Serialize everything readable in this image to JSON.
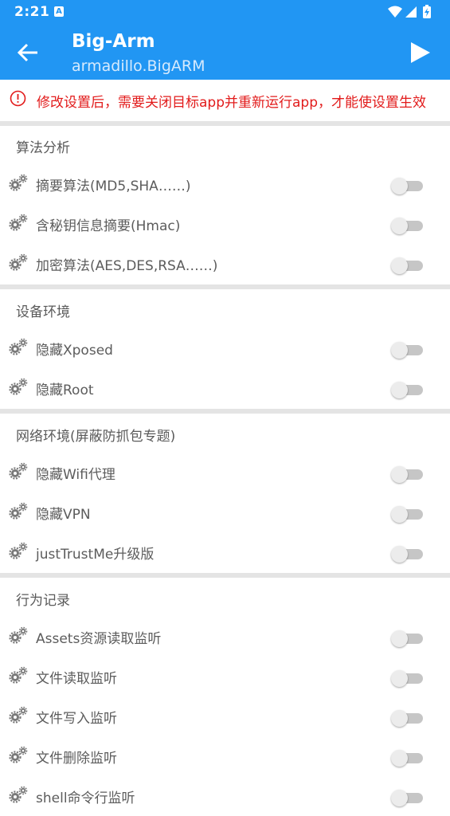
{
  "status_bar": {
    "time": "2:21",
    "notification_icon": "A"
  },
  "app_bar": {
    "title": "Big-Arm",
    "subtitle": "armadillo.BigARM",
    "back_icon": "arrow-left-icon",
    "action_icon": "play-icon"
  },
  "warning": {
    "icon": "alert-circle-icon",
    "text": "修改设置后，需要关闭目标app并重新运行app，才能使设置生效",
    "color": "#e21b1b"
  },
  "colors": {
    "primary": "#2196f3",
    "switch_off_track": "#c6c6c6",
    "switch_off_thumb": "#ececec"
  },
  "sections": [
    {
      "title": "算法分析",
      "items": [
        {
          "label": "摘要算法(MD5,SHA……)",
          "enabled": false
        },
        {
          "label": "含秘钥信息摘要(Hmac)",
          "enabled": false
        },
        {
          "label": "加密算法(AES,DES,RSA……)",
          "enabled": false
        }
      ]
    },
    {
      "title": "设备环境",
      "items": [
        {
          "label": "隐藏Xposed",
          "enabled": false
        },
        {
          "label": "隐藏Root",
          "enabled": false
        }
      ]
    },
    {
      "title": "网络环境(屏蔽防抓包专题)",
      "items": [
        {
          "label": "隐藏Wifi代理",
          "enabled": false
        },
        {
          "label": "隐藏VPN",
          "enabled": false
        },
        {
          "label": "justTrustMe升级版",
          "enabled": false
        }
      ]
    },
    {
      "title": "行为记录",
      "items": [
        {
          "label": "Assets资源读取监听",
          "enabled": false
        },
        {
          "label": "文件读取监听",
          "enabled": false
        },
        {
          "label": "文件写入监听",
          "enabled": false
        },
        {
          "label": "文件删除监听",
          "enabled": false
        },
        {
          "label": "shell命令行监听",
          "enabled": false
        }
      ]
    }
  ]
}
